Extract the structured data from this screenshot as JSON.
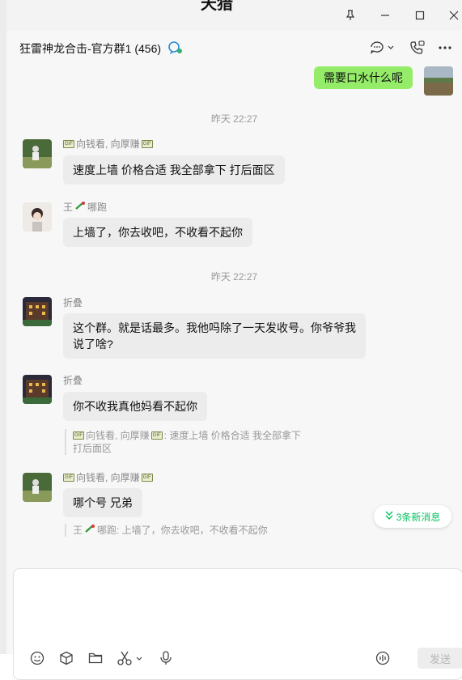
{
  "window": {
    "title_fragment": "天猎"
  },
  "header": {
    "group_name": "狂雷神龙合击-官方群1 (456)"
  },
  "messages": {
    "mine_1": "需要口水什么呢",
    "time_1": "昨天 22:27",
    "m1": {
      "sender_a": "向钱看, 向厚赚",
      "tag": "GIF",
      "text": "速度上墙 价格合适 我全部拿下 打后面区"
    },
    "m2": {
      "sender_a": "王",
      "sender_b": "哪跑",
      "text": "上墙了，你去收吧，不收看不起你"
    },
    "time_2": "昨天 22:27",
    "m3": {
      "sender": "折叠",
      "line1": "这个群。就是话最多。我他吗除了一天发收号。你爷爷我",
      "line2": "说了啥?"
    },
    "m4": {
      "sender": "折叠",
      "text": "你不收我真他妈看不起你",
      "quote_name": "向钱看, 向厚赚",
      "quote_line1": ": 速度上墙 价格合适 我全部拿下",
      "quote_line2": "打后面区"
    },
    "m5": {
      "sender_a": "向钱看, 向厚赚",
      "text": "哪个号 兄弟",
      "quote_a": "王",
      "quote_b": "哪跑: 上墙了，你去收吧，不收看不起你"
    }
  },
  "new_messages": "3条新消息",
  "input": {
    "send_label": "发送"
  },
  "colors": {
    "accent": "#07c160",
    "mine_bubble": "#95ec69",
    "bubble": "#ececec"
  }
}
